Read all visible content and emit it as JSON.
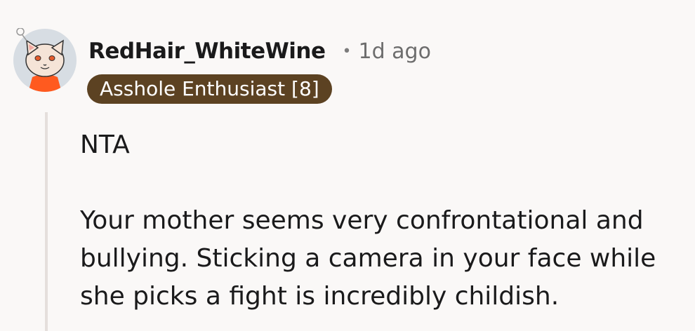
{
  "comment": {
    "author": "RedHair_WhiteWine",
    "separator": "•",
    "timestamp": "1d ago",
    "flair": "Asshole Enthusiast [8]",
    "body": [
      "NTA",
      "Your mother seems very confrontational and bullying. Sticking a camera in your face while she picks a fight is incredibly childish."
    ]
  },
  "avatar": {
    "icon": "cat-avatar-icon",
    "colors": {
      "ring": "#d7dde3",
      "face": "#f5e4d7",
      "shirt": "#ff5a1f",
      "eyes": "#e45c2d"
    }
  },
  "colors": {
    "background": "#faf8f7",
    "flair_bg": "#5c4222",
    "flair_text": "#ffffff",
    "thread_line": "#e5dfdc",
    "muted_text": "#6d6d6d"
  }
}
